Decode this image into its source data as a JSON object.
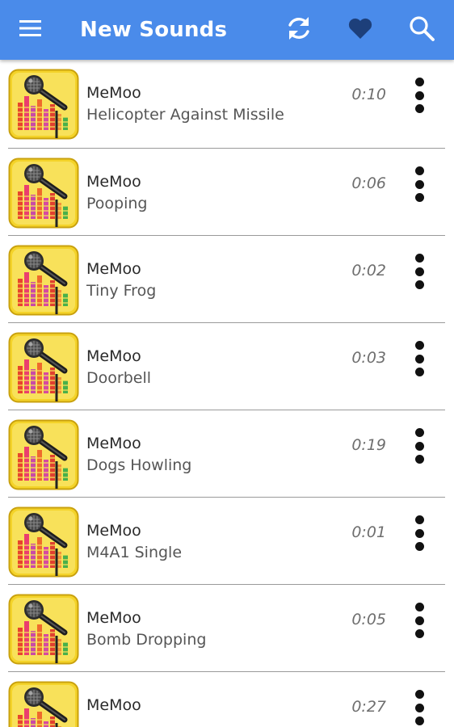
{
  "header": {
    "title": "New Sounds",
    "background_color": "#4a8bea",
    "icons": [
      "menu-icon",
      "refresh-icon",
      "heart-icon",
      "search-icon"
    ]
  },
  "sounds": [
    {
      "artist": "MeMoo",
      "name": "Helicopter Against Missile",
      "duration": "0:10"
    },
    {
      "artist": "MeMoo",
      "name": "Pooping",
      "duration": "0:06"
    },
    {
      "artist": "MeMoo",
      "name": "Tiny Frog",
      "duration": "0:02"
    },
    {
      "artist": "MeMoo",
      "name": "Doorbell",
      "duration": "0:03"
    },
    {
      "artist": "MeMoo",
      "name": "Dogs Howling",
      "duration": "0:19"
    },
    {
      "artist": "MeMoo",
      "name": "M4A1 Single",
      "duration": "0:01"
    },
    {
      "artist": "MeMoo",
      "name": "Bomb Dropping",
      "duration": "0:05"
    },
    {
      "artist": "MeMoo",
      "name": "",
      "duration": "0:27"
    }
  ]
}
